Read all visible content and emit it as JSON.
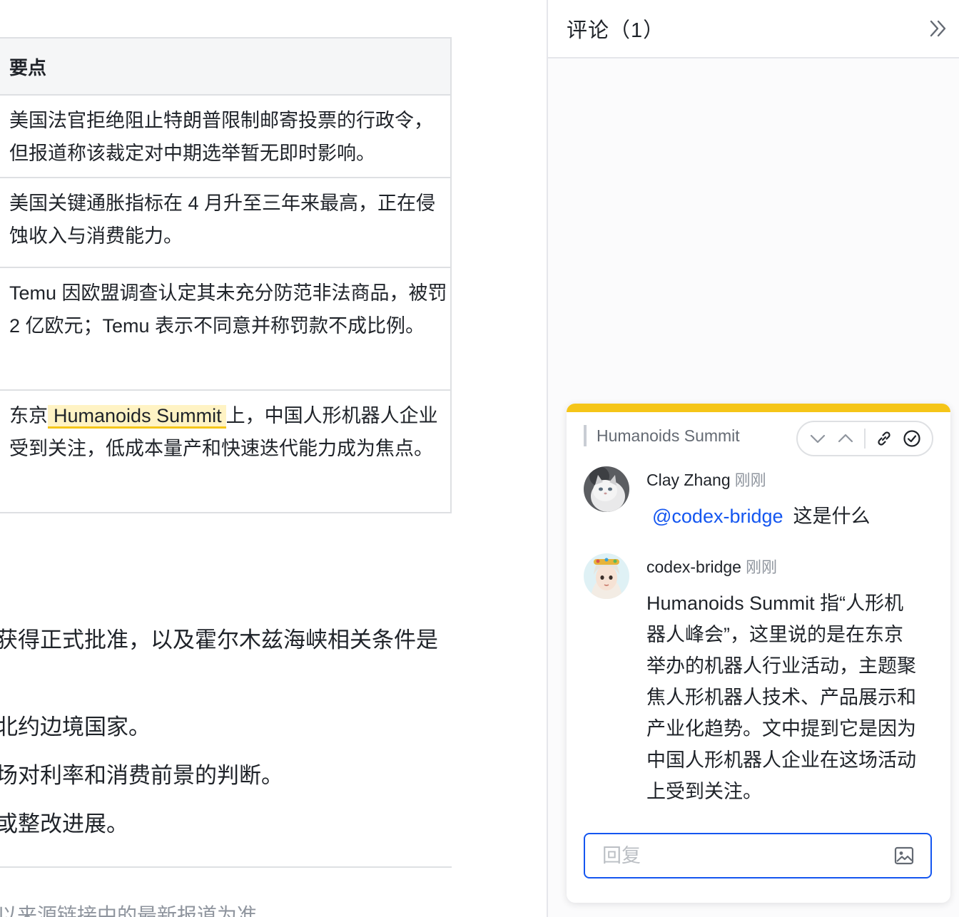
{
  "table": {
    "header": "要点",
    "rows": [
      "美国法官拒绝阻止特朗普限制邮寄投票的行政令，但报道称该裁定对中期选举暂无即时影响。",
      "美国关键通胀指标在 4 月升至三年来最高，正在侵蚀收入与消费能力。",
      "Temu 因欧盟调查认定其未充分防范非法商品，被罚 2 亿欧元；Temu 表示不同意并称罚款不成比例。"
    ],
    "row4": {
      "before": "东京",
      "highlight": "Humanoids Summit",
      "after": "上，中国人形机器人企业受到关注，低成本量产和快速迭代能力成为焦点。"
    }
  },
  "paragraphs": [
    "获得正式批准，以及霍尔木兹海峡相关条件是",
    "北约边境国家。",
    "场对利率和消费前景的判断。",
    "或整改进展。"
  ],
  "footnote": "以来源链接中的最新报道为准",
  "panel": {
    "title": "评论（1）",
    "colors": {
      "accent": "#1456f0",
      "highlight": "#f5c518"
    },
    "thread": {
      "quote": "Humanoids Summit",
      "comments": [
        {
          "author": "Clay Zhang",
          "time": "刚刚",
          "mention": "@codex-bridge",
          "text": "这是什么"
        },
        {
          "author": "codex-bridge",
          "time": "刚刚",
          "lines": [
            "Humanoids Summit 指“人形机",
            "器人峰会”，这里说的是在东京",
            "举办的机器人行业活动，主题聚",
            "焦人形机器人技术、产品展示和",
            "产业化趋势。文中提到它是因为",
            "中国人形机器人企业在这场活动",
            "上受到关注。"
          ]
        }
      ],
      "reply_placeholder": "回复"
    }
  }
}
